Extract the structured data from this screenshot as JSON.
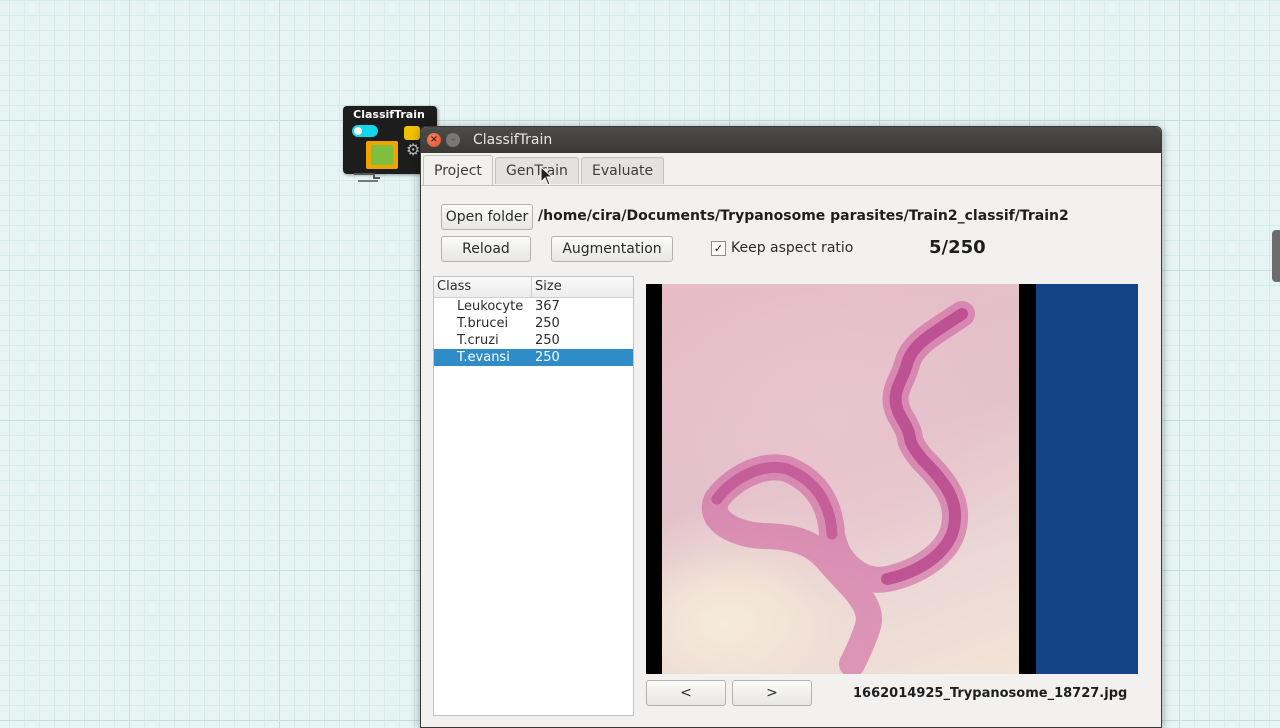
{
  "node": {
    "title": "ClassifTrain"
  },
  "window": {
    "title": "ClassifTrain"
  },
  "tabs": [
    {
      "label": "Project"
    },
    {
      "label": "GenTrain"
    },
    {
      "label": "Evaluate"
    }
  ],
  "project": {
    "open_folder_label": "Open folder",
    "folder_path": "/home/cira/Documents/Trypanosome parasites/Train2_classif/Train2",
    "reload_label": "Reload",
    "augmentation_label": "Augmentation",
    "keep_aspect_label": "Keep aspect ratio",
    "keep_aspect_checked": true,
    "counter": "5/250",
    "prev_label": "<",
    "next_label": ">",
    "filename": "1662014925_Trypanosome_18727.jpg"
  },
  "class_table": {
    "headers": [
      "Class",
      "Size"
    ],
    "rows": [
      {
        "class": "Leukocyte",
        "size": "367"
      },
      {
        "class": "T.brucei",
        "size": "250"
      },
      {
        "class": "T.cruzi",
        "size": "250"
      },
      {
        "class": "T.evansi",
        "size": "250"
      }
    ],
    "selected_index": 3
  },
  "colors": {
    "selection": "#308cc6",
    "viewer_bg": "#134383",
    "toggle": "#13d6e8"
  }
}
